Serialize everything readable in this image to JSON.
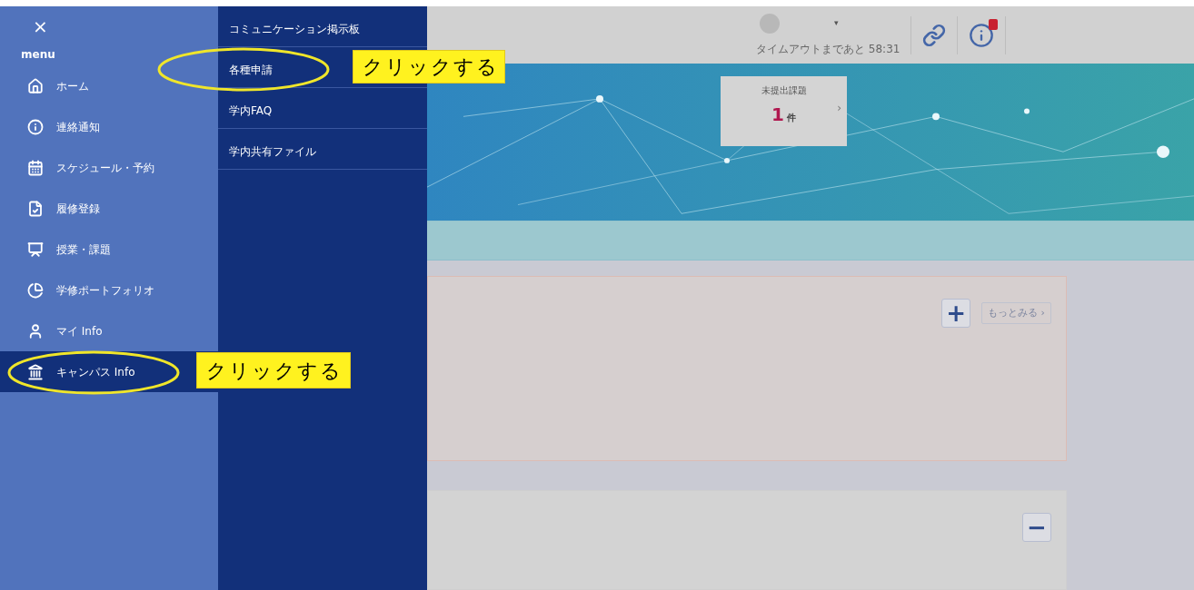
{
  "menu": {
    "close": "×",
    "label": "menu",
    "items": [
      {
        "label": "ホーム",
        "selected": false
      },
      {
        "label": "連絡通知",
        "selected": false
      },
      {
        "label": "スケジュール・予約",
        "selected": false
      },
      {
        "label": "履修登録",
        "selected": false
      },
      {
        "label": "授業・課題",
        "selected": false
      },
      {
        "label": "学修ポートフォリオ",
        "selected": false
      },
      {
        "label": "マイ Info",
        "selected": false
      },
      {
        "label": "キャンパス Info",
        "selected": true,
        "annotation": "クリックする"
      }
    ]
  },
  "submenu": {
    "items": [
      {
        "label": "コミュニケーション掲示板"
      },
      {
        "label": "各種申請",
        "annotation": "クリックする"
      },
      {
        "label": "学内FAQ"
      },
      {
        "label": "学内共有ファイル"
      }
    ]
  },
  "header": {
    "caret": "▾",
    "timeout": "タイムアウトまであと 58:31"
  },
  "banner": {
    "kind": "picture",
    "summary_card": {
      "title": "未提出課題",
      "count": "1",
      "unit": "件",
      "chevron": "›"
    }
  },
  "panels": [
    {
      "kind": "expand",
      "button": "+",
      "more_link": "もっとみる ›"
    },
    {
      "kind": "collapse",
      "button": "−"
    }
  ]
}
